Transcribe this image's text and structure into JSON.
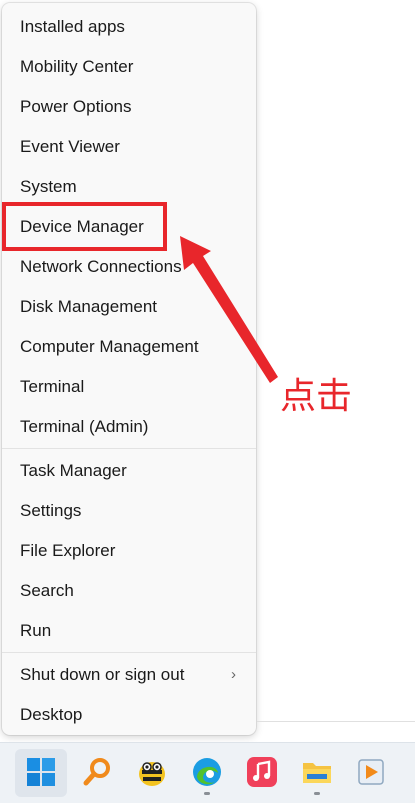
{
  "menu": {
    "items": [
      {
        "label": "Installed apps"
      },
      {
        "label": "Mobility Center"
      },
      {
        "label": "Power Options"
      },
      {
        "label": "Event Viewer"
      },
      {
        "label": "System"
      },
      {
        "label": "Device Manager"
      },
      {
        "label": "Network Connections"
      },
      {
        "label": "Disk Management"
      },
      {
        "label": "Computer Management"
      },
      {
        "label": "Terminal"
      },
      {
        "label": "Terminal (Admin)"
      },
      {
        "label": "Task Manager"
      },
      {
        "label": "Settings"
      },
      {
        "label": "File Explorer"
      },
      {
        "label": "Search"
      },
      {
        "label": "Run"
      },
      {
        "label": "Shut down or sign out"
      },
      {
        "label": "Desktop"
      }
    ],
    "chevron": "›"
  },
  "annotation": {
    "text": "点击",
    "color": "#e8262b"
  },
  "taskbar": {
    "icons": [
      "windows-start-icon",
      "search-magnifier-icon",
      "bee-app-icon",
      "edge-browser-icon",
      "music-app-icon",
      "file-explorer-icon",
      "media-player-icon"
    ]
  }
}
